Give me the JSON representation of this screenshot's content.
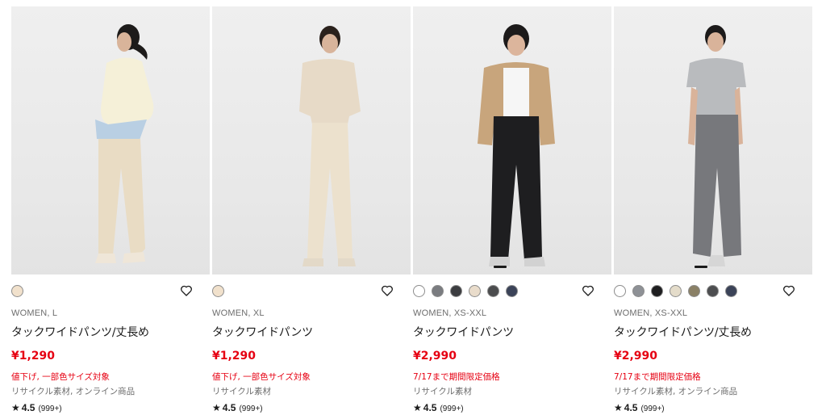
{
  "products": [
    {
      "photo_desc": "woman in cream sweater and beige wide pants",
      "swatches": [
        "#f1e1cc"
      ],
      "category": "WOMEN, L",
      "name": "タックワイドパンツ/丈長め",
      "price": "¥1,290",
      "promo": "値下げ, 一部色サイズ対象",
      "note": "リサイクル素材, オンライン商品",
      "rating_star": "★",
      "rating": "4.5",
      "reviews": "(999+)"
    },
    {
      "photo_desc": "woman in beige shirt and beige wide pants",
      "swatches": [
        "#f1e1cc"
      ],
      "category": "WOMEN, XL",
      "name": "タックワイドパンツ",
      "price": "¥1,290",
      "promo": "値下げ, 一部色サイズ対象",
      "note": "リサイクル素材",
      "rating_star": "★",
      "rating": "4.5",
      "reviews": "(999+)"
    },
    {
      "photo_desc": "woman in tan jacket and black wide pants",
      "swatches": [
        "#ffffff",
        "#7a7c80",
        "#3c3d40",
        "#e9dccb",
        "#4b4c4e",
        "#3b4358"
      ],
      "category": "WOMEN, XS-XXL",
      "name": "タックワイドパンツ",
      "price": "¥2,990",
      "promo": "7/17まで期間限定価格",
      "note": "リサイクル素材",
      "rating_star": "★",
      "rating": "4.5",
      "reviews": "(999+)"
    },
    {
      "photo_desc": "woman in gray t-shirt and gray wide pants",
      "swatches": [
        "#ffffff",
        "#8e9196",
        "#1e1e20",
        "#e4dcca",
        "#8a8066",
        "#4d4e50",
        "#3b4358"
      ],
      "category": "WOMEN, XS-XXL",
      "name": "タックワイドパンツ/丈長め",
      "price": "¥2,990",
      "promo": "7/17まで期間限定価格",
      "note": "リサイクル素材, オンライン商品",
      "rating_star": "★",
      "rating": "4.5",
      "reviews": "(999+)"
    }
  ],
  "colors": {
    "price_red": "#e60012",
    "text_dark": "#1b1b1b",
    "text_gray": "#6d6d6d"
  },
  "icons": {
    "favorite": "heart-icon",
    "rating": "star-icon"
  }
}
